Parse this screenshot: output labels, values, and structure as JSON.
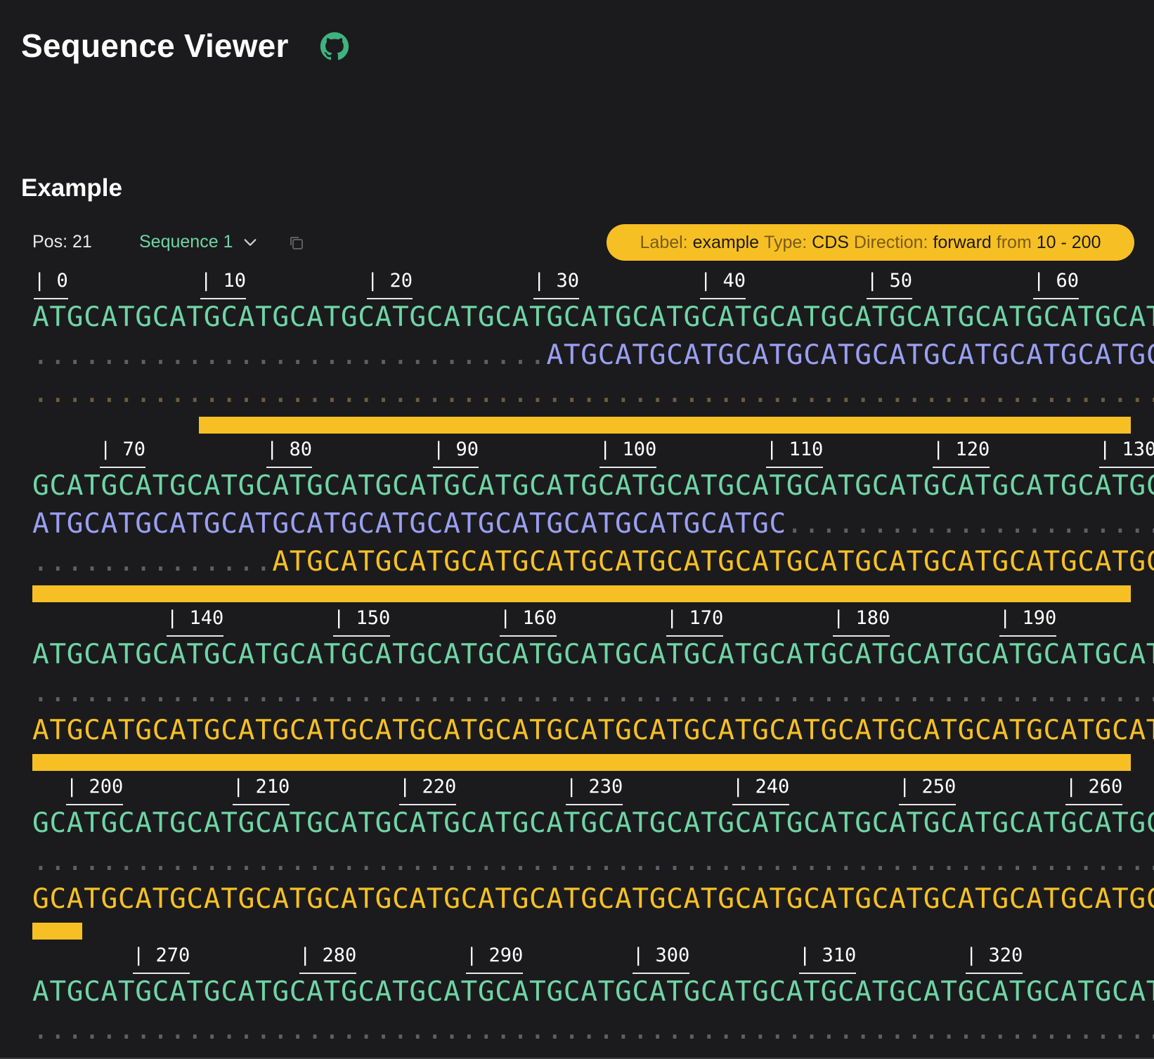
{
  "app": {
    "title": "Sequence Viewer",
    "github_icon": "github-icon"
  },
  "section": {
    "title": "Example"
  },
  "toolbar": {
    "position": "Pos: 21",
    "sequence_select": "Sequence 1",
    "copy_icon": "copy-icon"
  },
  "tooltip": {
    "label_key": "Label:",
    "label": "example",
    "type_key": "Type:",
    "type": "CDS",
    "direction_key": "Direction:",
    "direction": "forward",
    "from_key": "from",
    "range": "10 - 200"
  },
  "colors": {
    "accent_green": "#6fd5a5",
    "feature_yellow": "#f6c025",
    "purple": "#9a9ff2",
    "background": "#1b1b1d"
  },
  "rows": [
    {
      "ticks": [
        "| 0",
        "| 10",
        "| 20",
        "| 30",
        "| 40",
        "| 50",
        "| 60"
      ],
      "sequence": "ATGCATGCATGCATGCATGCATGCATGCATGCATGCATGCATGCATGCATGCATGCATGCATGCAT",
      "lines": [
        {
          "dots": "..............................",
          "text": "ATGCATGCATGCATGCATGCATGCATGCATGCATGC",
          "color": "purple"
        },
        {
          "dots": "..................................................................",
          "text": "",
          "color": "yellow"
        }
      ]
    },
    {
      "ticks": [
        "| 70",
        "| 80",
        "| 90",
        "| 100",
        "| 110",
        "| 120",
        "| 130"
      ],
      "sequence": "GCATGCATGCATGCATGCATGCATGCATGCATGCATGCATGCATGCATGCATGCATGCATGCATGC",
      "lines": [
        {
          "text": "ATGCATGCATGCATGCATGCATGCATGCATGCATGCATGCATGC",
          "dots": "......................",
          "color": "purple"
        },
        {
          "dots": "..............",
          "text": "ATGCATGCATGCATGCATGCATGCATGCATGCATGCATGCATGCATGCATGC",
          "color": "yellow"
        }
      ]
    },
    {
      "ticks": [
        "| 140",
        "| 150",
        "| 160",
        "| 170",
        "| 180",
        "| 190"
      ],
      "sequence": "ATGCATGCATGCATGCATGCATGCATGCATGCATGCATGCATGCATGCATGCATGCATGCATGCAT",
      "lines": [
        {
          "dots": "..................................................................",
          "text": "",
          "color": "purple"
        },
        {
          "dots": "",
          "text": "ATGCATGCATGCATGCATGCATGCATGCATGCATGCATGCATGCATGCATGCATGCATGCATGCAT",
          "color": "yellow"
        }
      ]
    },
    {
      "ticks": [
        "| 200",
        "| 210",
        "| 220",
        "| 230",
        "| 240",
        "| 250",
        "| 260"
      ],
      "sequence": "GCATGCATGCATGCATGCATGCATGCATGCATGCATGCATGCATGCATGCATGCATGCATGCATGC",
      "lines": [
        {
          "dots": "..................................................................",
          "text": "",
          "color": "purple"
        },
        {
          "dots": "",
          "text": "GCATGCATGCATGCATGCATGCATGCATGCATGCATGCATGCATGCATGCATGCATGCATGCATGC",
          "color": "yellow"
        }
      ]
    },
    {
      "ticks": [
        "| 270",
        "| 280",
        "| 290",
        "| 300",
        "| 310",
        "| 320"
      ],
      "sequence": "ATGCATGCATGCATGCATGCATGCATGCATGCATGCATGCATGCATGCATGCATGCATGCATGCAT",
      "lines": [
        {
          "dots": "..................................................................",
          "text": "",
          "color": "purple"
        }
      ]
    }
  ]
}
